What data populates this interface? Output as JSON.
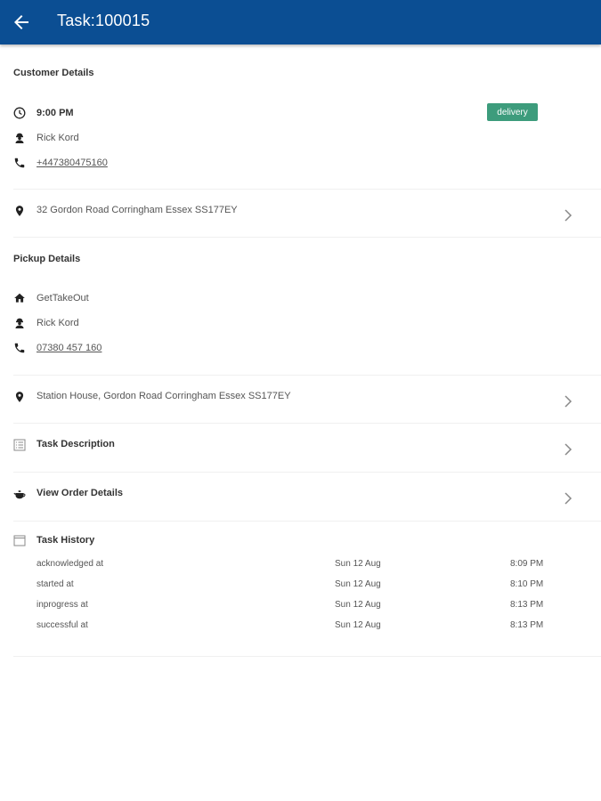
{
  "header": {
    "title": "Task:100015"
  },
  "customer": {
    "section_title": "Customer Details",
    "time": "9:00 PM",
    "badge": "delivery",
    "name": "Rick Kord",
    "phone": "+447380475160",
    "address": "32 Gordon Road Corringham Essex SS177EY"
  },
  "pickup": {
    "section_title": "Pickup Details",
    "store": "GetTakeOut",
    "name": "Rick Kord",
    "phone": "07380 457 160",
    "address": "Station House, Gordon Road Corringham Essex SS177EY"
  },
  "links": {
    "task_description": "Task Description",
    "view_order_details": "View Order Details"
  },
  "history": {
    "title": "Task History",
    "rows": [
      {
        "event": "acknowledged at",
        "date": "Sun 12 Aug",
        "time": "8:09 PM"
      },
      {
        "event": "started at",
        "date": "Sun 12 Aug",
        "time": "8:10 PM"
      },
      {
        "event": "inprogress at",
        "date": "Sun 12 Aug",
        "time": "8:13 PM"
      },
      {
        "event": "successful at",
        "date": "Sun 12 Aug",
        "time": "8:13 PM"
      }
    ]
  },
  "colors": {
    "appbar": "#0b4e93",
    "badge": "#3d9c7c"
  }
}
